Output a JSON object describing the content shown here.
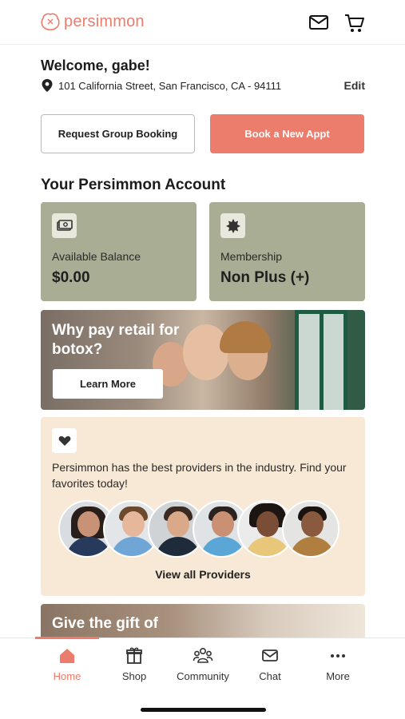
{
  "header": {
    "brand": "persimmon",
    "logo_icon": "persimmon-fruit-icon",
    "mail_icon": "mail-icon",
    "cart_icon": "cart-icon"
  },
  "welcome": {
    "greeting": "Welcome, gabe!",
    "address_icon": "location-pin-icon",
    "address": "101 California Street, San Francisco, CA - 94111",
    "edit_label": "Edit"
  },
  "actions": {
    "group_booking_label": "Request Group Booking",
    "book_appt_label": "Book a New Appt"
  },
  "account": {
    "title": "Your Persimmon Account",
    "balance": {
      "icon": "cash-icon",
      "label": "Available Balance",
      "value": "$0.00"
    },
    "membership": {
      "icon": "badge-star-icon",
      "label": "Membership",
      "value": "Non Plus (+)"
    }
  },
  "promo": {
    "title": "Why pay retail for botox?",
    "button_label": "Learn More"
  },
  "providers": {
    "icon": "heart-icon",
    "text": "Persimmon has the best providers in the industry. Find your favorites today!",
    "view_all_label": "View all Providers"
  },
  "gift": {
    "title": "Give the gift of"
  },
  "tabbar": {
    "tabs": [
      {
        "label": "Home",
        "icon": "home-icon",
        "active": true
      },
      {
        "label": "Shop",
        "icon": "gift-box-icon",
        "active": false
      },
      {
        "label": "Community",
        "icon": "community-icon",
        "active": false
      },
      {
        "label": "Chat",
        "icon": "chat-icon",
        "active": false
      },
      {
        "label": "More",
        "icon": "more-dots-icon",
        "active": false
      }
    ]
  },
  "colors": {
    "accent": "#ec7c6b",
    "card_green": "#a9ad94",
    "providers_bg": "#f8e9d6"
  }
}
